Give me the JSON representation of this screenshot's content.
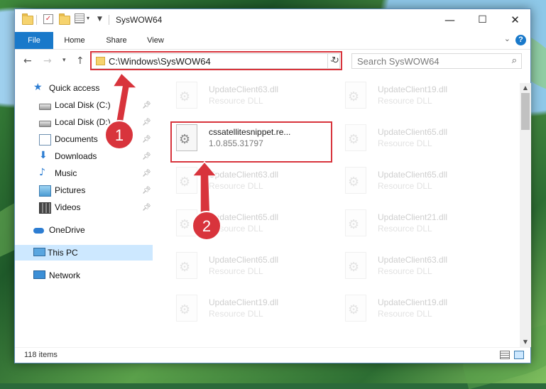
{
  "window": {
    "title": "SysWOW64",
    "minimize": "—",
    "maximize": "☐",
    "close": "✕"
  },
  "ribbon": {
    "tabs": [
      "File",
      "Home",
      "Share",
      "View"
    ],
    "help": "?"
  },
  "address_bar": {
    "path": "C:\\Windows\\SysWOW64",
    "search_placeholder": "Search SysWOW64"
  },
  "nav_pane": {
    "items": [
      {
        "label": "Quick access",
        "icon": "star-icon"
      },
      {
        "label": "Local Disk (C:)",
        "icon": "drive-icon",
        "pinned": true
      },
      {
        "label": "Local Disk (D:)",
        "icon": "drive-icon",
        "pinned": true
      },
      {
        "label": "Documents",
        "icon": "documents-icon",
        "pinned": true
      },
      {
        "label": "Downloads",
        "icon": "download-icon",
        "pinned": true
      },
      {
        "label": "Music",
        "icon": "music-icon",
        "pinned": true
      },
      {
        "label": "Pictures",
        "icon": "pictures-icon",
        "pinned": true
      },
      {
        "label": "Videos",
        "icon": "videos-icon",
        "pinned": true
      },
      {
        "label": "OneDrive",
        "icon": "onedrive-icon"
      },
      {
        "label": "This PC",
        "icon": "this-pc-icon",
        "selected": true
      },
      {
        "label": "Network",
        "icon": "network-icon"
      }
    ]
  },
  "files": {
    "left_column": [
      {
        "name": "UpdateClient63.dll",
        "sub": "Resource DLL",
        "faded": true
      },
      {
        "name": "cssatellitesnippet.re...",
        "sub": "1.0.855.31797",
        "faded": false,
        "highlighted": true
      },
      {
        "name": "UpdateClient63.dll",
        "sub": "Resource DLL",
        "faded": true
      },
      {
        "name": "UpdateClient65.dll",
        "sub": "Resource DLL",
        "faded": true
      },
      {
        "name": "UpdateClient65.dll",
        "sub": "Resource DLL",
        "faded": true
      },
      {
        "name": "UpdateClient19.dll",
        "sub": "Resource DLL",
        "faded": true
      }
    ],
    "right_column": [
      {
        "name": "UpdateClient19.dll",
        "sub": "Resource DLL",
        "faded": true
      },
      {
        "name": "UpdateClient65.dll",
        "sub": "Resource DLL",
        "faded": true
      },
      {
        "name": "UpdateClient65.dll",
        "sub": "Resource DLL",
        "faded": true
      },
      {
        "name": "UpdateClient21.dll",
        "sub": "Resource DLL",
        "faded": true
      },
      {
        "name": "UpdateClient63.dll",
        "sub": "Resource DLL",
        "faded": true
      },
      {
        "name": "UpdateClient19.dll",
        "sub": "Resource DLL",
        "faded": true
      }
    ]
  },
  "status": {
    "item_count": "118 items"
  },
  "annotations": {
    "step1": "1",
    "step2": "2",
    "accent_color": "#d8343c"
  }
}
